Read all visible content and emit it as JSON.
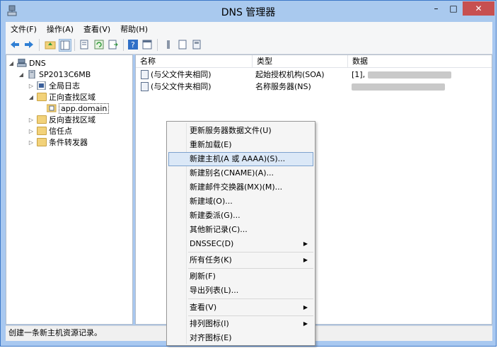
{
  "window": {
    "title": "DNS 管理器",
    "controls": {
      "minimize": "–",
      "maximize": "□",
      "close": "✕"
    }
  },
  "menubar": [
    "文件(F)",
    "操作(A)",
    "查看(V)",
    "帮助(H)"
  ],
  "toolbar": {
    "icons": [
      "back-arrow-icon",
      "forward-arrow-icon",
      "up-folder-icon",
      "show-hide-tree-icon",
      "properties-icon",
      "refresh-icon",
      "export-icon",
      "help-icon",
      "console-icon",
      "list-icon",
      "filter-icon"
    ]
  },
  "tree": {
    "items": [
      {
        "label": "DNS",
        "level": 0,
        "expanded": true,
        "icon": "dns-icon"
      },
      {
        "label": "SP2013C6MB",
        "level": 1,
        "expanded": true,
        "icon": "server-icon"
      },
      {
        "label": "全局日志",
        "level": 2,
        "expanded": false,
        "icon": "log-icon"
      },
      {
        "label": "正向查找区域",
        "level": 2,
        "expanded": true,
        "icon": "folder-icon"
      },
      {
        "label": "app.domain",
        "level": 3,
        "expanded": false,
        "icon": "zone-icon",
        "selected": true
      },
      {
        "label": "反向查找区域",
        "level": 2,
        "expanded": false,
        "icon": "folder-icon"
      },
      {
        "label": "信任点",
        "level": 2,
        "expanded": false,
        "icon": "folder-icon"
      },
      {
        "label": "条件转发器",
        "level": 2,
        "expanded": false,
        "icon": "folder-icon"
      }
    ]
  },
  "list": {
    "columns": [
      "名称",
      "类型",
      "数据"
    ],
    "rows": [
      {
        "name": "(与父文件夹相同)",
        "type": "起始授权机构(SOA)",
        "data": "[1],"
      },
      {
        "name": "(与父文件夹相同)",
        "type": "名称服务器(NS)",
        "data": ""
      }
    ]
  },
  "context_menu": {
    "items": [
      {
        "label": "更新服务器数据文件(U)",
        "submenu": false
      },
      {
        "label": "重新加载(E)",
        "submenu": false
      },
      {
        "label": "新建主机(A 或 AAAA)(S)...",
        "submenu": false,
        "highlighted": true
      },
      {
        "label": "新建别名(CNAME)(A)...",
        "submenu": false
      },
      {
        "label": "新建邮件交换器(MX)(M)...",
        "submenu": false
      },
      {
        "label": "新建域(O)...",
        "submenu": false
      },
      {
        "label": "新建委派(G)...",
        "submenu": false
      },
      {
        "label": "其他新记录(C)...",
        "submenu": false
      },
      {
        "label": "DNSSEC(D)",
        "submenu": true
      },
      {
        "label": "所有任务(K)",
        "submenu": true
      },
      {
        "label": "刷新(F)",
        "submenu": false
      },
      {
        "label": "导出列表(L)...",
        "submenu": false
      },
      {
        "label": "查看(V)",
        "submenu": true
      },
      {
        "label": "排列图标(I)",
        "submenu": true
      },
      {
        "label": "对齐图标(E)",
        "submenu": false
      }
    ],
    "submenu_arrow": "▶"
  },
  "status_bar": {
    "text": "创建一条新主机资源记录。"
  },
  "colors": {
    "title_bar": "#a9c9ee",
    "close_button": "#c75050",
    "highlight": "#dbe8f7"
  }
}
